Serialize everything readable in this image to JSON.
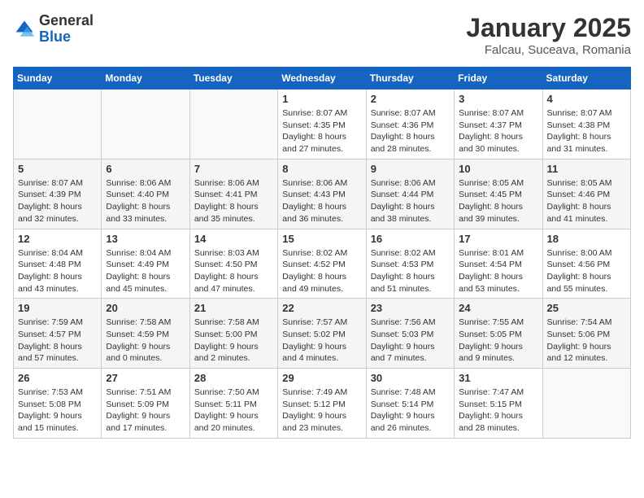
{
  "logo": {
    "general": "General",
    "blue": "Blue"
  },
  "header": {
    "month": "January 2025",
    "location": "Falcau, Suceava, Romania"
  },
  "weekdays": [
    "Sunday",
    "Monday",
    "Tuesday",
    "Wednesday",
    "Thursday",
    "Friday",
    "Saturday"
  ],
  "weeks": [
    [
      {
        "day": "",
        "info": ""
      },
      {
        "day": "",
        "info": ""
      },
      {
        "day": "",
        "info": ""
      },
      {
        "day": "1",
        "info": "Sunrise: 8:07 AM\nSunset: 4:35 PM\nDaylight: 8 hours and 27 minutes."
      },
      {
        "day": "2",
        "info": "Sunrise: 8:07 AM\nSunset: 4:36 PM\nDaylight: 8 hours and 28 minutes."
      },
      {
        "day": "3",
        "info": "Sunrise: 8:07 AM\nSunset: 4:37 PM\nDaylight: 8 hours and 30 minutes."
      },
      {
        "day": "4",
        "info": "Sunrise: 8:07 AM\nSunset: 4:38 PM\nDaylight: 8 hours and 31 minutes."
      }
    ],
    [
      {
        "day": "5",
        "info": "Sunrise: 8:07 AM\nSunset: 4:39 PM\nDaylight: 8 hours and 32 minutes."
      },
      {
        "day": "6",
        "info": "Sunrise: 8:06 AM\nSunset: 4:40 PM\nDaylight: 8 hours and 33 minutes."
      },
      {
        "day": "7",
        "info": "Sunrise: 8:06 AM\nSunset: 4:41 PM\nDaylight: 8 hours and 35 minutes."
      },
      {
        "day": "8",
        "info": "Sunrise: 8:06 AM\nSunset: 4:43 PM\nDaylight: 8 hours and 36 minutes."
      },
      {
        "day": "9",
        "info": "Sunrise: 8:06 AM\nSunset: 4:44 PM\nDaylight: 8 hours and 38 minutes."
      },
      {
        "day": "10",
        "info": "Sunrise: 8:05 AM\nSunset: 4:45 PM\nDaylight: 8 hours and 39 minutes."
      },
      {
        "day": "11",
        "info": "Sunrise: 8:05 AM\nSunset: 4:46 PM\nDaylight: 8 hours and 41 minutes."
      }
    ],
    [
      {
        "day": "12",
        "info": "Sunrise: 8:04 AM\nSunset: 4:48 PM\nDaylight: 8 hours and 43 minutes."
      },
      {
        "day": "13",
        "info": "Sunrise: 8:04 AM\nSunset: 4:49 PM\nDaylight: 8 hours and 45 minutes."
      },
      {
        "day": "14",
        "info": "Sunrise: 8:03 AM\nSunset: 4:50 PM\nDaylight: 8 hours and 47 minutes."
      },
      {
        "day": "15",
        "info": "Sunrise: 8:02 AM\nSunset: 4:52 PM\nDaylight: 8 hours and 49 minutes."
      },
      {
        "day": "16",
        "info": "Sunrise: 8:02 AM\nSunset: 4:53 PM\nDaylight: 8 hours and 51 minutes."
      },
      {
        "day": "17",
        "info": "Sunrise: 8:01 AM\nSunset: 4:54 PM\nDaylight: 8 hours and 53 minutes."
      },
      {
        "day": "18",
        "info": "Sunrise: 8:00 AM\nSunset: 4:56 PM\nDaylight: 8 hours and 55 minutes."
      }
    ],
    [
      {
        "day": "19",
        "info": "Sunrise: 7:59 AM\nSunset: 4:57 PM\nDaylight: 8 hours and 57 minutes."
      },
      {
        "day": "20",
        "info": "Sunrise: 7:58 AM\nSunset: 4:59 PM\nDaylight: 9 hours and 0 minutes."
      },
      {
        "day": "21",
        "info": "Sunrise: 7:58 AM\nSunset: 5:00 PM\nDaylight: 9 hours and 2 minutes."
      },
      {
        "day": "22",
        "info": "Sunrise: 7:57 AM\nSunset: 5:02 PM\nDaylight: 9 hours and 4 minutes."
      },
      {
        "day": "23",
        "info": "Sunrise: 7:56 AM\nSunset: 5:03 PM\nDaylight: 9 hours and 7 minutes."
      },
      {
        "day": "24",
        "info": "Sunrise: 7:55 AM\nSunset: 5:05 PM\nDaylight: 9 hours and 9 minutes."
      },
      {
        "day": "25",
        "info": "Sunrise: 7:54 AM\nSunset: 5:06 PM\nDaylight: 9 hours and 12 minutes."
      }
    ],
    [
      {
        "day": "26",
        "info": "Sunrise: 7:53 AM\nSunset: 5:08 PM\nDaylight: 9 hours and 15 minutes."
      },
      {
        "day": "27",
        "info": "Sunrise: 7:51 AM\nSunset: 5:09 PM\nDaylight: 9 hours and 17 minutes."
      },
      {
        "day": "28",
        "info": "Sunrise: 7:50 AM\nSunset: 5:11 PM\nDaylight: 9 hours and 20 minutes."
      },
      {
        "day": "29",
        "info": "Sunrise: 7:49 AM\nSunset: 5:12 PM\nDaylight: 9 hours and 23 minutes."
      },
      {
        "day": "30",
        "info": "Sunrise: 7:48 AM\nSunset: 5:14 PM\nDaylight: 9 hours and 26 minutes."
      },
      {
        "day": "31",
        "info": "Sunrise: 7:47 AM\nSunset: 5:15 PM\nDaylight: 9 hours and 28 minutes."
      },
      {
        "day": "",
        "info": ""
      }
    ]
  ]
}
